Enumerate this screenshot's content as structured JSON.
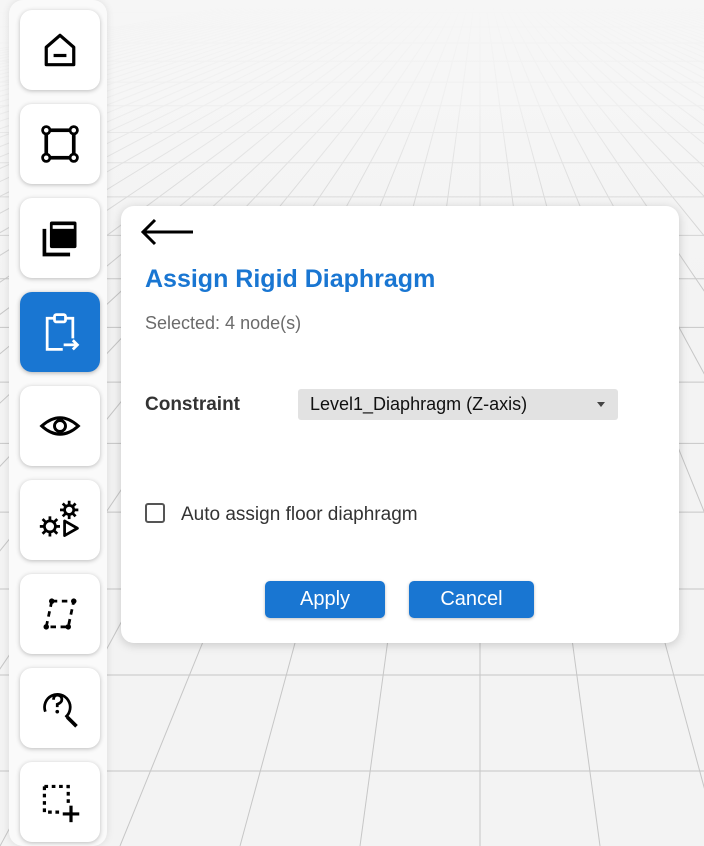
{
  "toolbar": {
    "tools": [
      {
        "icon": "home-icon",
        "active": false
      },
      {
        "icon": "frame-nodes-icon",
        "active": false
      },
      {
        "icon": "layers-icon",
        "active": false
      },
      {
        "icon": "clipboard-assign-icon",
        "active": true
      },
      {
        "icon": "eye-icon",
        "active": false
      },
      {
        "icon": "gears-run-icon",
        "active": false
      },
      {
        "icon": "dashed-parallelogram-icon",
        "active": false
      },
      {
        "icon": "search-help-icon",
        "active": false
      },
      {
        "icon": "add-selection-icon",
        "active": false
      }
    ]
  },
  "dialog": {
    "title": "Assign Rigid Diaphragm",
    "subtitle": "Selected: 4 node(s)",
    "constraint_label": "Constraint",
    "constraint_value": "Level1_Diaphragm (Z-axis)",
    "checkbox_label": "Auto assign floor diaphragm",
    "checkbox_checked": false,
    "apply_label": "Apply",
    "cancel_label": "Cancel"
  },
  "colors": {
    "accent": "#1976d2",
    "background": "#f3f3f3",
    "grid_line": "#c6c6c6"
  }
}
